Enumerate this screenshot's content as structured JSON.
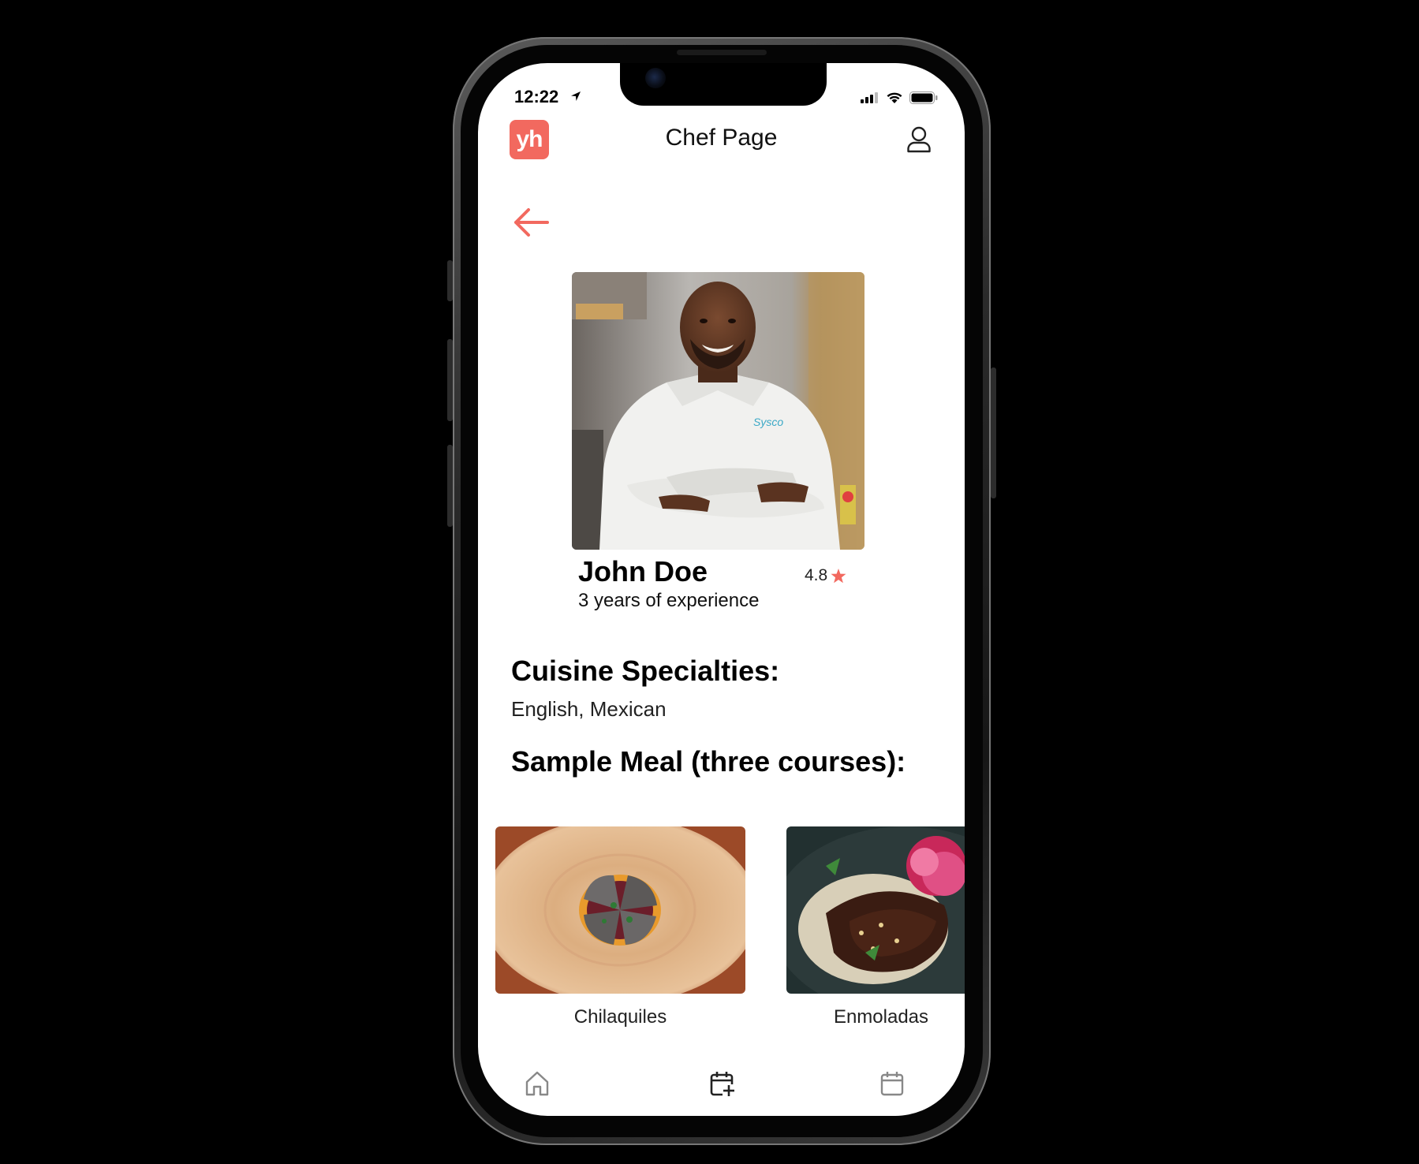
{
  "status_bar": {
    "time": "12:22",
    "icons": [
      "location-arrow-icon",
      "signal-icon",
      "wifi-icon",
      "battery-icon"
    ]
  },
  "header": {
    "logo_text": "yh",
    "title": "Chef Page",
    "profile_icon": "user-icon"
  },
  "chef": {
    "name": "John Doe",
    "experience": "3 years of experience",
    "rating": "4.8",
    "photo_logo_text": "Sysco"
  },
  "cuisine": {
    "heading": "Cuisine Specialties:",
    "value": "English, Mexican"
  },
  "sample_meal": {
    "heading": "Sample Meal (three courses):",
    "items": [
      {
        "label": "Chilaquiles"
      },
      {
        "label": "Enmoladas"
      }
    ]
  },
  "bottom_nav": {
    "items": [
      {
        "icon": "home-icon"
      },
      {
        "icon": "calendar-add-icon"
      },
      {
        "icon": "calendar-icon"
      }
    ]
  },
  "colors": {
    "accent": "#f2695f",
    "background": "#000000",
    "screen": "#ffffff"
  }
}
